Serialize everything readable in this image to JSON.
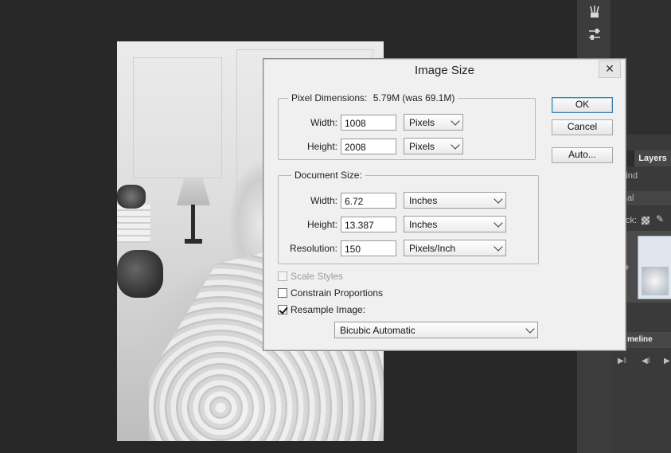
{
  "dialog": {
    "title": "Image Size",
    "close_glyph": "✕",
    "buttons": {
      "ok": "OK",
      "cancel": "Cancel",
      "auto": "Auto..."
    },
    "pixel_dimensions": {
      "label": "Pixel Dimensions:",
      "summary": "5.79M (was 69.1M)",
      "width_label": "Width:",
      "width_value": "1008",
      "width_unit": "Pixels",
      "height_label": "Height:",
      "height_value": "2008",
      "height_unit": "Pixels"
    },
    "document_size": {
      "label": "Document Size:",
      "width_label": "Width:",
      "width_value": "6.72",
      "width_unit": "Inches",
      "height_label": "Height:",
      "height_value": "13.387",
      "height_unit": "Inches",
      "resolution_label": "Resolution:",
      "resolution_value": "150",
      "resolution_unit": "Pixels/Inch"
    },
    "options": {
      "scale_styles": {
        "label": "Scale Styles",
        "checked": false,
        "disabled": true
      },
      "constrain_proportions": {
        "label": "Constrain Proportions",
        "checked": false
      },
      "resample_image": {
        "label": "Resample Image:",
        "checked": true
      },
      "resample_method": "Bicubic Automatic"
    }
  },
  "right_panel": {
    "layers_tab": "Layers",
    "kind_filter": "Kind",
    "blend_mode": "ormal",
    "lock_label": "ck:",
    "timeline_tab": "meline"
  },
  "icons": [
    "brushes-icon",
    "sliders-icon",
    "close-icon",
    "chevron-down-icon",
    "checkmark-icon",
    "eye-icon",
    "lock-transparency-icon",
    "brush-icon",
    "go-to-first-frame-icon",
    "previous-frame-icon"
  ]
}
